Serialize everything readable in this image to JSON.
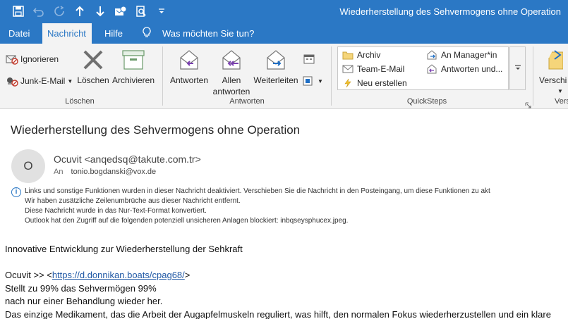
{
  "window": {
    "title": "Wiederherstellung des Sehvermogens ohne Operation"
  },
  "quick_access": {
    "icons": [
      "save-icon",
      "undo-icon",
      "redo-icon",
      "up-arrow-icon",
      "down-arrow-icon",
      "mailbox-icon",
      "print-preview-icon",
      "customize-dropdown-icon"
    ]
  },
  "tabs": [
    {
      "label": "Datei"
    },
    {
      "label": "Nachricht"
    },
    {
      "label": "Hilfe"
    }
  ],
  "tell_me": {
    "label": "Was möchten Sie tun?"
  },
  "ribbon": {
    "delete_group": {
      "label": "Löschen",
      "ignore": "Ignorieren",
      "junk": "Junk-E-Mail",
      "delete": "Löschen",
      "archive": "Archivieren"
    },
    "respond_group": {
      "label": "Antworten",
      "reply": "Antworten",
      "reply_all_line1": "Allen",
      "reply_all_line2": "antworten",
      "forward": "Weiterleiten"
    },
    "quicksteps": {
      "label": "QuickSteps",
      "items": [
        {
          "label": "Archiv"
        },
        {
          "label": "An Manager*in"
        },
        {
          "label": "Team-E-Mail"
        },
        {
          "label": "Antworten und..."
        },
        {
          "label": "Neu erstellen"
        }
      ]
    },
    "move_group": {
      "move_label": "Verschi",
      "group_label": "Vers"
    }
  },
  "message": {
    "subject": "Wiederherstellung des Sehvermogens ohne Operation",
    "avatar_initial": "O",
    "sender": "Ocuvit <anqedsq@takute.com.tr>",
    "to_label": "An",
    "to": "tonio.bogdanski@vox.de",
    "info_lines": [
      "Links und sonstige Funktionen wurden in dieser Nachricht deaktiviert. Verschieben Sie die Nachricht in den Posteingang, um diese Funktionen zu akt",
      "Wir haben zusätzliche Zeilenumbrüche aus dieser Nachricht entfernt.",
      "Diese Nachricht wurde in das Nur-Text-Format konvertiert.",
      "Outlook hat den Zugriff auf die folgenden potenziell unsicheren Anlagen blockiert: inbqseysphucex.jpeg."
    ],
    "body": {
      "line1": "Innovative Entwicklung zur Wiederherstellung der Sehkraft",
      "link_prefix": "Ocuvit >> <",
      "link": "https://d.donnikan.boats/cpag68/",
      "link_suffix": ">",
      "line3": "Stellt zu 99% das Sehvermögen 99%",
      "line4": "nach nur einer Behandlung wieder her.",
      "line5": "Das einzige Medikament, das die Arbeit der Augapfelmuskeln reguliert, was hilft, den normalen Fokus wiederherzustellen und ein klare"
    }
  },
  "colors": {
    "accent": "#2b78c5",
    "ribbon_bg": "#f3f3f3",
    "link": "#1f58a5"
  }
}
